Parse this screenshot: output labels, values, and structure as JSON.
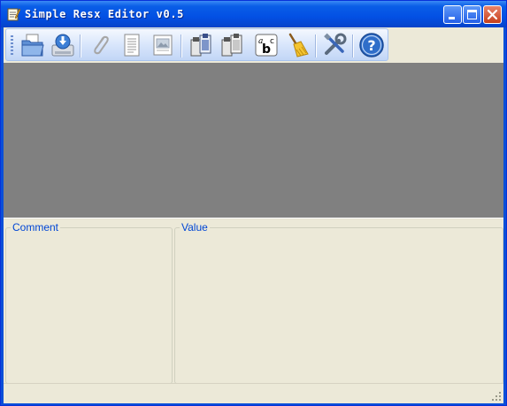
{
  "window": {
    "title": "Simple Resx Editor v0.5",
    "controls": {
      "minimize": "minimize-icon",
      "maximize": "maximize-icon",
      "close": "close-icon"
    }
  },
  "toolbar": {
    "items": [
      {
        "id": "open",
        "icon": "open-folder-icon"
      },
      {
        "id": "save",
        "icon": "save-disk-icon"
      },
      {
        "id": "attach",
        "icon": "paperclip-icon"
      },
      {
        "id": "document",
        "icon": "document-icon"
      },
      {
        "id": "image",
        "icon": "image-document-icon"
      },
      {
        "id": "clipboard-add",
        "icon": "clipboard-icon"
      },
      {
        "id": "clipboard-copy",
        "icon": "clipboard-copy-icon"
      },
      {
        "id": "spelling",
        "icon": "abc-spelling-icon"
      },
      {
        "id": "clean",
        "icon": "broom-icon"
      },
      {
        "id": "settings",
        "icon": "tools-icon"
      },
      {
        "id": "help",
        "icon": "help-icon"
      }
    ]
  },
  "panels": {
    "comment_label": "Comment",
    "value_label": "Value"
  },
  "colors": {
    "titlebar": "#0350e4",
    "client_background": "#ece9d8",
    "grid_background": "#808080",
    "group_title": "#0046d5"
  }
}
